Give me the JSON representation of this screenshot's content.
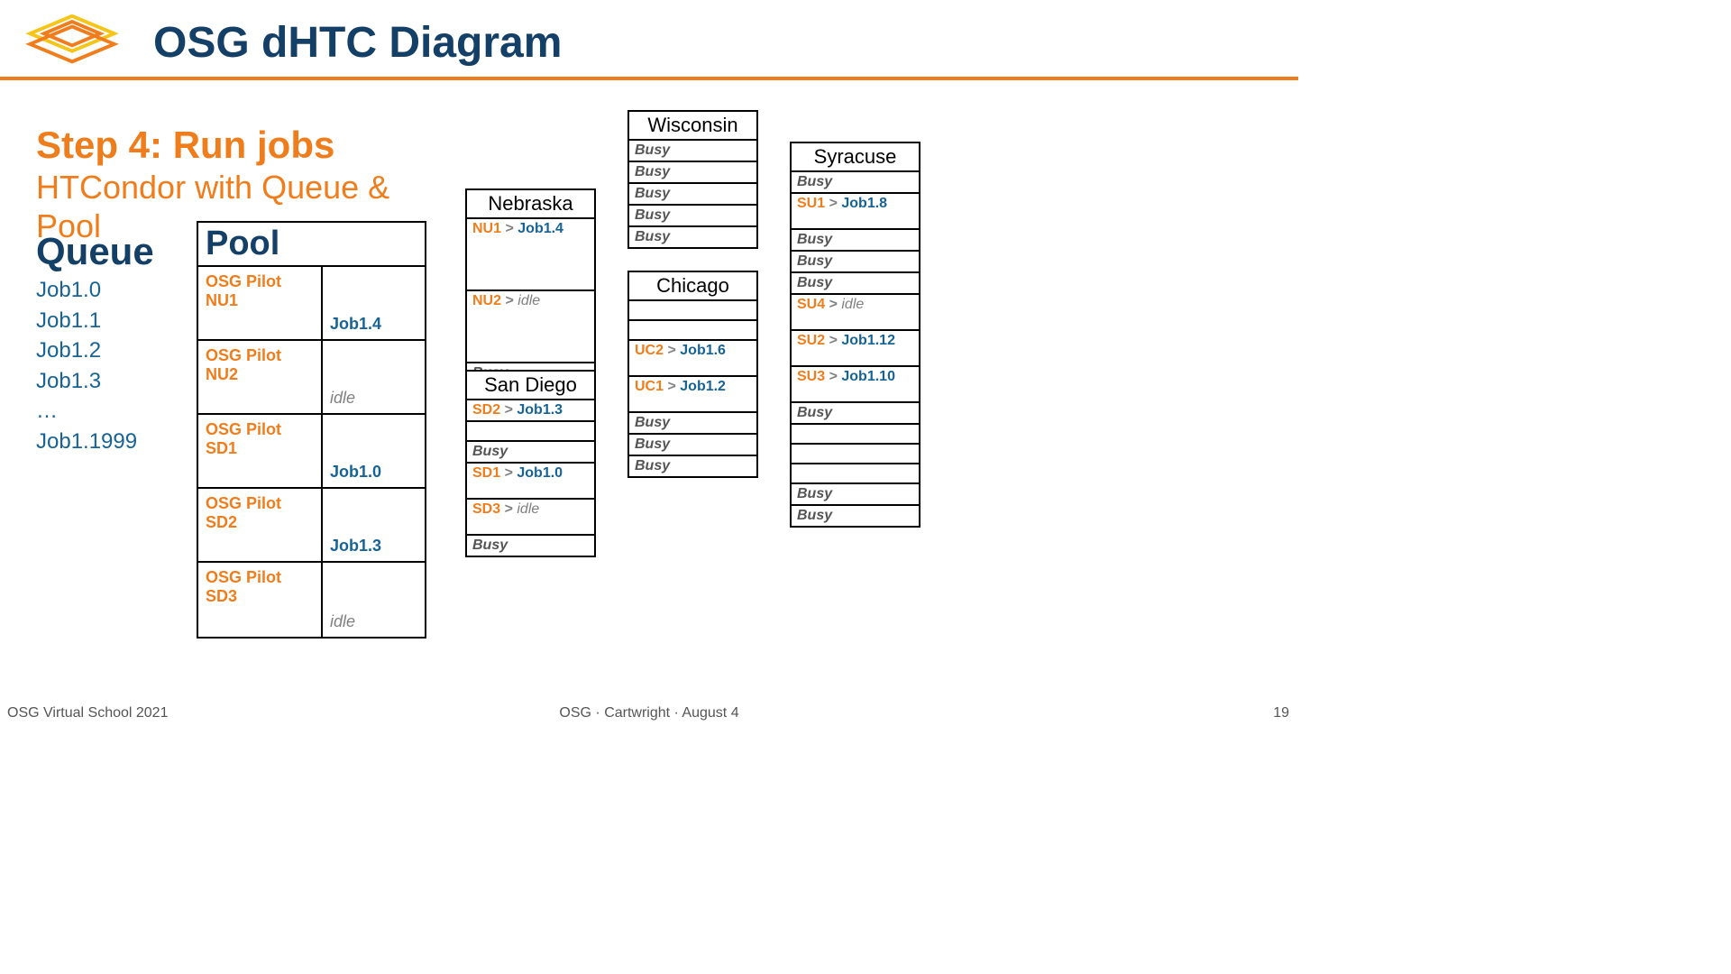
{
  "title": "OSG dHTC Diagram",
  "step": "Step 4: Run jobs",
  "subtitle1": "HTCondor with Queue &",
  "subtitle2": "Pool",
  "queue_heading": "Queue",
  "queue_items": [
    "Job1.0",
    "Job1.1",
    "Job1.2",
    "Job1.3",
    "…",
    "Job1.1999"
  ],
  "pool_heading": "Pool",
  "pool": [
    {
      "pilot": "OSG Pilot NU1",
      "job": "Job1.4",
      "idle": false
    },
    {
      "pilot": "OSG Pilot NU2",
      "job": "idle",
      "idle": true
    },
    {
      "pilot": "OSG Pilot SD1",
      "job": "Job1.0",
      "idle": false
    },
    {
      "pilot": "OSG Pilot SD2",
      "job": "Job1.3",
      "idle": false
    },
    {
      "pilot": "OSG Pilot SD3",
      "job": "idle",
      "idle": true
    }
  ],
  "sites": {
    "nebraska": {
      "name": "Nebraska",
      "slots": [
        {
          "type": "pilot",
          "pilot": "NU1",
          "job": "Job1.4",
          "tall": true
        },
        {
          "type": "pilot-idle",
          "pilot": "NU2",
          "job": "idle",
          "tall": true
        },
        {
          "type": "busy"
        },
        {
          "type": "busy"
        }
      ]
    },
    "sandiego": {
      "name": "San Diego",
      "slots": [
        {
          "type": "pilot",
          "pilot": "SD2",
          "job": "Job1.3"
        },
        {
          "type": "empty"
        },
        {
          "type": "busy"
        },
        {
          "type": "pilot",
          "pilot": "SD1",
          "job": "Job1.0",
          "med": true
        },
        {
          "type": "pilot-idle",
          "pilot": "SD3",
          "job": "idle",
          "med": true
        },
        {
          "type": "busy"
        }
      ]
    },
    "wisconsin": {
      "name": "Wisconsin",
      "slots": [
        {
          "type": "busy"
        },
        {
          "type": "busy"
        },
        {
          "type": "busy"
        },
        {
          "type": "busy"
        },
        {
          "type": "busy"
        }
      ]
    },
    "chicago": {
      "name": "Chicago",
      "slots": [
        {
          "type": "empty"
        },
        {
          "type": "empty"
        },
        {
          "type": "pilot",
          "pilot": "UC2",
          "job": "Job1.6",
          "med": true
        },
        {
          "type": "pilot",
          "pilot": "UC1",
          "job": "Job1.2",
          "med": true
        },
        {
          "type": "busy"
        },
        {
          "type": "busy"
        },
        {
          "type": "busy"
        }
      ]
    },
    "syracuse": {
      "name": "Syracuse",
      "slots": [
        {
          "type": "busy"
        },
        {
          "type": "pilot",
          "pilot": "SU1",
          "job": "Job1.8",
          "med": true
        },
        {
          "type": "busy"
        },
        {
          "type": "busy"
        },
        {
          "type": "busy"
        },
        {
          "type": "pilot-idle",
          "pilot": "SU4",
          "job": "idle",
          "med": true
        },
        {
          "type": "pilot",
          "pilot": "SU2",
          "job": "Job1.12",
          "med": true
        },
        {
          "type": "pilot",
          "pilot": "SU3",
          "job": "Job1.10",
          "med": true
        },
        {
          "type": "busy"
        },
        {
          "type": "empty"
        },
        {
          "type": "empty"
        },
        {
          "type": "empty"
        },
        {
          "type": "busy"
        },
        {
          "type": "busy"
        }
      ]
    }
  },
  "footer_left": "OSG Virtual School 2021",
  "footer_center": "OSG · Cartwright · August 4",
  "footer_right": "19"
}
